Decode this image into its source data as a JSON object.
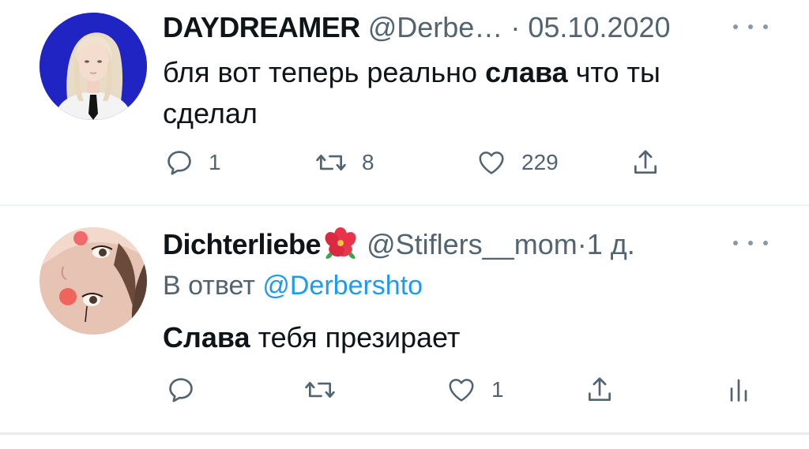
{
  "tweets": [
    {
      "author_name": "DAYDREAMER",
      "handle": "@Derbe…",
      "separator": "·",
      "date": "05.10.2020",
      "text_before": "бля вот теперь реально ",
      "text_bold": "слава",
      "text_after": " что ты сделал",
      "counts": {
        "replies": "1",
        "retweets": "8",
        "likes": "229"
      },
      "avatar_icon": "avatar-blonde-person-icon"
    },
    {
      "author_name": "Dichterliebe",
      "handle": "@Stiflers__mom",
      "separator": "·",
      "date": "1 д.",
      "reply_prefix": "В ответ",
      "reply_mention": "@Derbershto",
      "text_bold": "Слава",
      "text_after": " тебя презирает",
      "counts": {
        "likes": "1"
      },
      "avatar_icon": "avatar-face-icon",
      "name_emoji": "hibiscus-flower-icon"
    }
  ],
  "colors": {
    "text_primary": "#0f1419",
    "text_secondary": "#536471",
    "link": "#1d9bf0",
    "separator": "#eff3f4"
  }
}
